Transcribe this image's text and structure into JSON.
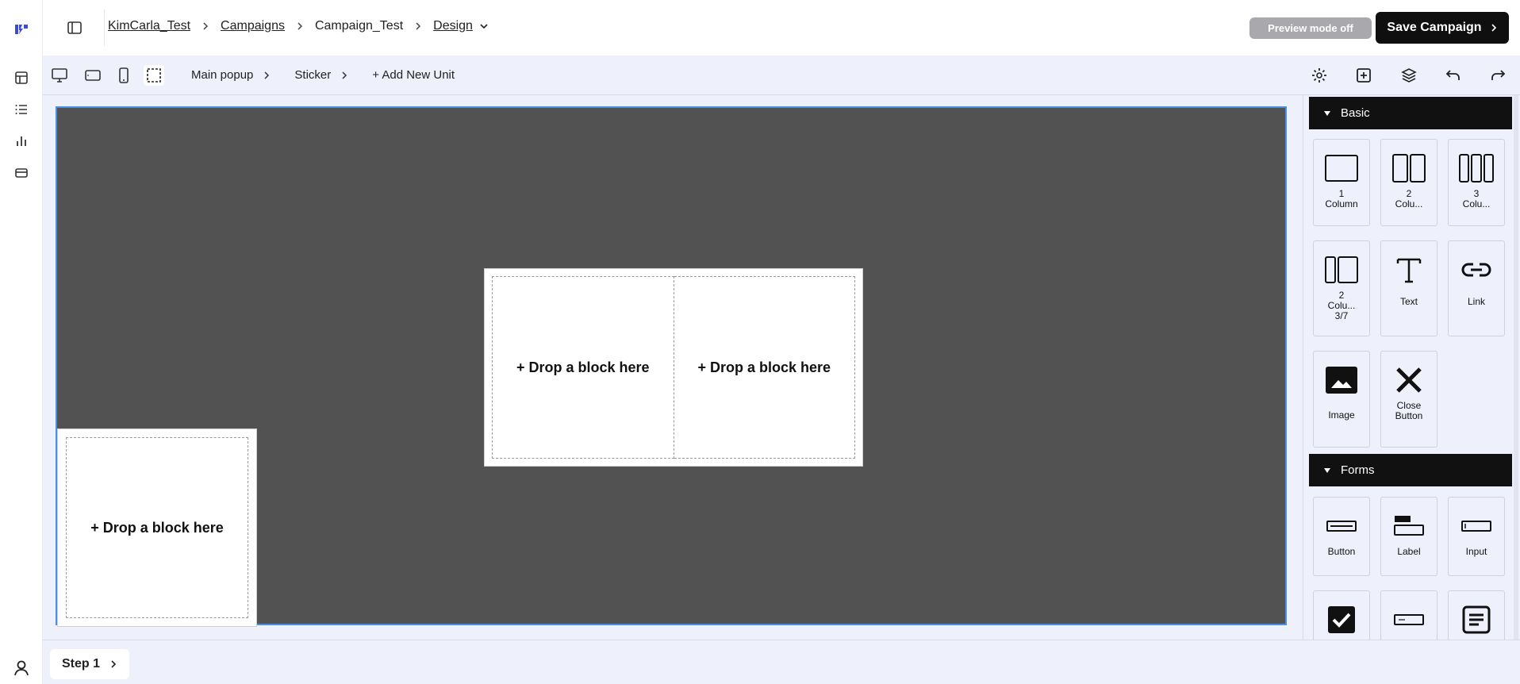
{
  "header": {
    "breadcrumbs": {
      "item1": "KimCarla_Test",
      "item2": "Campaigns",
      "item3": "Campaign_Test",
      "item4": "Design"
    },
    "preview_label": "Preview mode off",
    "save_label": "Save Campaign"
  },
  "toolbar": {
    "steps": {
      "main_popup": "Main popup",
      "sticker": "Sticker",
      "add_new": "+ Add New Unit"
    }
  },
  "canvas": {
    "popup": {
      "zone1": "+ Drop a block here",
      "zone2": "+ Drop a block here"
    },
    "sticker": {
      "zone1": "+ Drop a block here"
    }
  },
  "footer": {
    "step_label": "Step 1"
  },
  "panel": {
    "basic_title": "Basic",
    "forms_title": "Forms",
    "basic": {
      "one_col": "1\nColumn",
      "two_col": "2\nColu...",
      "three_col": "3\nColu...",
      "two_col_37": "2\nColu...\n3/7",
      "text": "Text",
      "link": "Link",
      "image": "Image",
      "close": "Close\nButton"
    },
    "forms": {
      "button": "Button",
      "label": "Label",
      "input": "Input"
    }
  },
  "colors": {
    "canvas_bg": "#525252",
    "selection": "#4a90e2",
    "toolbar_bg": "#eef0fb",
    "brand": "#3b4bdb"
  }
}
